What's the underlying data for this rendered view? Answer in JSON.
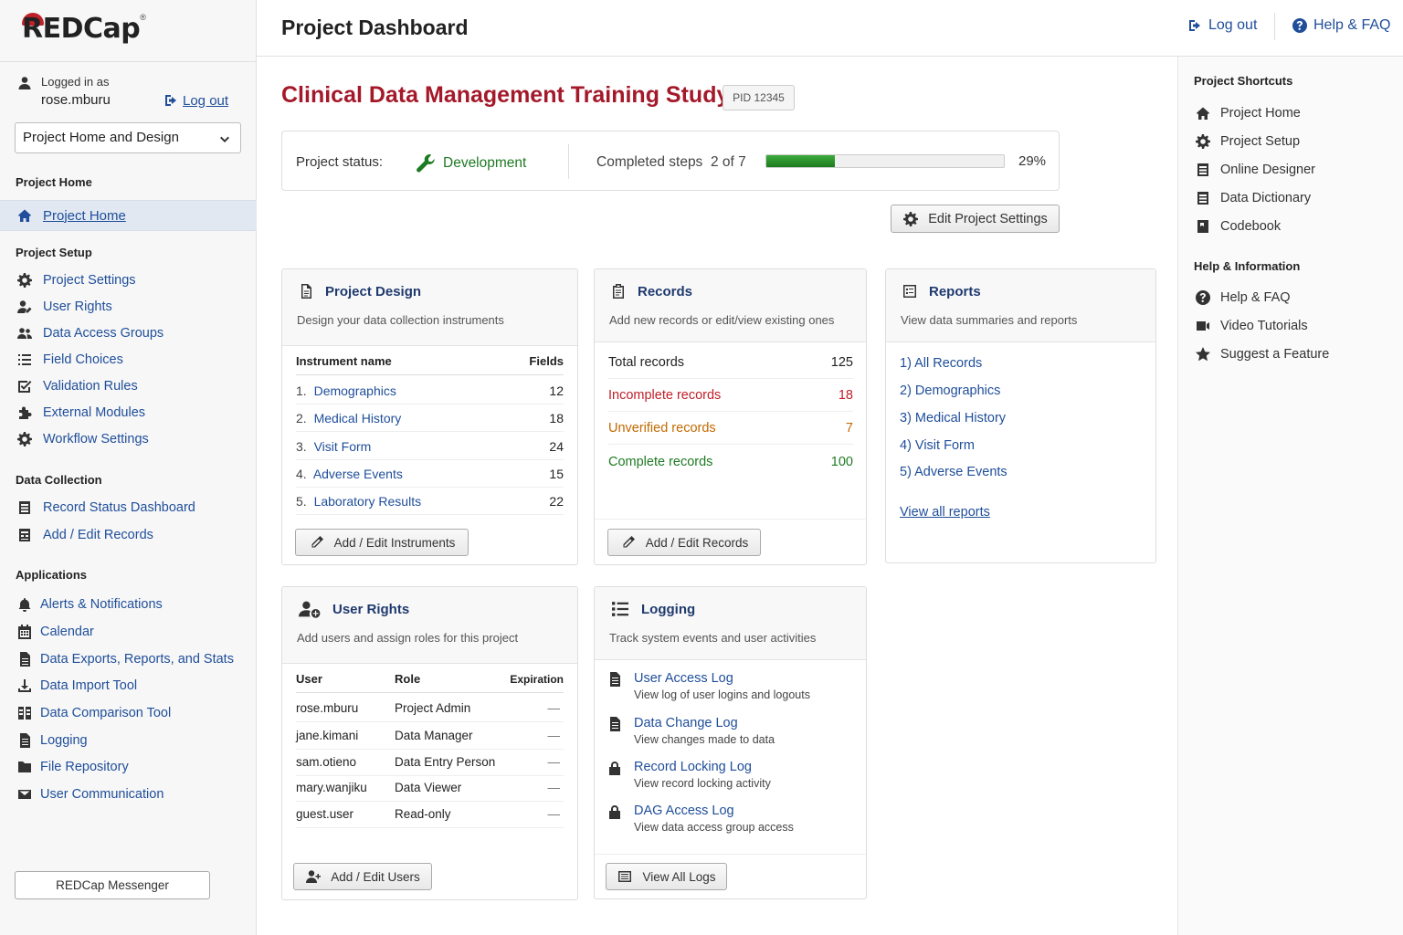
{
  "brand": {
    "logo_text": "REDCap",
    "reg": "®"
  },
  "header": {
    "title": "Project Dashboard",
    "logout": "Log out",
    "help": "Help & FAQ"
  },
  "user": {
    "logged_in_as": "Logged in as",
    "username": "rose.mburu",
    "logout": "Log out"
  },
  "nav_select": {
    "value": "Project Home and Design"
  },
  "sidebar": {
    "sections": {
      "home": "Project Home",
      "setup": "Project Setup",
      "collection": "Data Collection",
      "applications": "Applications"
    },
    "home_item": "Project Home",
    "setup_items": [
      "Project Settings",
      "User Rights",
      "Data Access Groups",
      "Field Choices",
      "Validation Rules",
      "External Modules",
      "Workflow Settings"
    ],
    "collection_items": [
      "Record Status Dashboard",
      "Add / Edit Records"
    ],
    "app_items": [
      "Alerts & Notifications",
      "Calendar",
      "Data Exports, Reports, and Stats",
      "Data Import Tool",
      "Data Comparison Tool",
      "Logging",
      "File Repository",
      "User Communication"
    ],
    "messenger": "REDCap Messenger"
  },
  "project": {
    "title": "Clinical Data Management Training Study",
    "pid": "PID 12345",
    "status_label": "Project status:",
    "status": "Development",
    "steps_label": "Completed steps",
    "steps": "2 of 7",
    "progress": 29,
    "progress_text": "29%",
    "edit_settings": "Edit Project Settings"
  },
  "design_card": {
    "title": "Project Design",
    "subtitle": "Design your data collection instruments",
    "col_name": "Instrument name",
    "col_fields": "Fields",
    "rows": [
      {
        "n": "1.",
        "name": "Demographics",
        "fields": "12"
      },
      {
        "n": "2.",
        "name": "Medical History",
        "fields": "18"
      },
      {
        "n": "3.",
        "name": "Visit Form",
        "fields": "24"
      },
      {
        "n": "4.",
        "name": "Adverse Events",
        "fields": "15"
      },
      {
        "n": "5.",
        "name": "Laboratory Results",
        "fields": "22"
      }
    ],
    "button": "Add / Edit Instruments"
  },
  "records_card": {
    "title": "Records",
    "subtitle": "Add new records or edit/view existing ones",
    "rows": [
      {
        "label": "Total records",
        "value": "125",
        "color": "#222222"
      },
      {
        "label": "Incomplete records",
        "value": "18",
        "color": "#c0202a"
      },
      {
        "label": "Unverified records",
        "value": "7",
        "color": "#c26a00"
      },
      {
        "label": "Complete records",
        "value": "100",
        "color": "#1e7a22"
      }
    ],
    "button": "Add / Edit Records"
  },
  "reports_card": {
    "title": "Reports",
    "subtitle": "View data summaries and reports",
    "items": [
      "1) All Records",
      "2) Demographics",
      "3) Medical History",
      "4) Visit Form",
      "5) Adverse Events"
    ],
    "view_all": "View all reports"
  },
  "users_card": {
    "title": "User Rights",
    "subtitle": "Add users and assign roles for this project",
    "cols": [
      "User",
      "Role",
      "Expiration"
    ],
    "rows": [
      {
        "user": "rose.mburu",
        "role": "Project Admin",
        "exp": "—"
      },
      {
        "user": "jane.kimani",
        "role": "Data Manager",
        "exp": "—"
      },
      {
        "user": "sam.otieno",
        "role": "Data Entry Person",
        "exp": "—"
      },
      {
        "user": "mary.wanjiku",
        "role": "Data Viewer",
        "exp": "—"
      },
      {
        "user": "guest.user",
        "role": "Read-only",
        "exp": "—"
      }
    ],
    "button": "Add / Edit Users"
  },
  "logging_card": {
    "title": "Logging",
    "subtitle": "Track system events and user activities",
    "items": [
      {
        "title": "User Access Log",
        "desc": "View log of user logins and logouts"
      },
      {
        "title": "Data Change Log",
        "desc": "View changes made to data"
      },
      {
        "title": "Record Locking Log",
        "desc": "View record locking activity"
      },
      {
        "title": "DAG Access Log",
        "desc": "View data access group access"
      }
    ],
    "button": "View All Logs"
  },
  "rail": {
    "shortcuts_title": "Project Shortcuts",
    "shortcuts": [
      "Project Home",
      "Project Setup",
      "Online Designer",
      "Data Dictionary",
      "Codebook"
    ],
    "help_title": "Help & Information",
    "help": [
      "Help & FAQ",
      "Video Tutorials",
      "Suggest a Feature"
    ]
  },
  "colors": {
    "brand_red": "#a4192a",
    "link": "#1f4e9a",
    "dev_green": "#1e7a22"
  }
}
